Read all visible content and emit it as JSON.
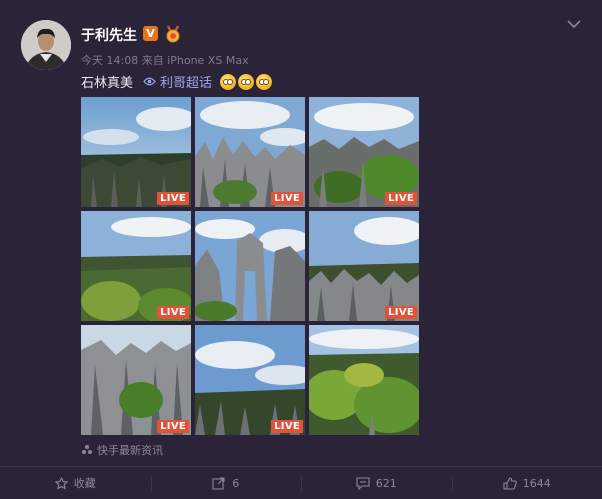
{
  "post": {
    "author": "于利先生",
    "verified_badge": "V",
    "time": "今天 14:08 来自 iPhone XS Max",
    "text": "石林真美",
    "topic": "利哥超话",
    "source_label": "快手最新资讯",
    "photo_badge": "LIVE",
    "photos": [
      {
        "live": true
      },
      {
        "live": true
      },
      {
        "live": true
      },
      {
        "live": true
      },
      {
        "live": false
      },
      {
        "live": true
      },
      {
        "live": true
      },
      {
        "live": true
      },
      {
        "live": false
      }
    ]
  },
  "actions": {
    "favorite": "收藏",
    "repost": "6",
    "comment": "621",
    "like": "1644"
  },
  "colors": {
    "background": "#2b2438",
    "topic": "#9da6ee",
    "live_badge": "#e0533a",
    "verified": "#e8731a"
  },
  "icons": [
    "chevron-down-icon",
    "topic-icon",
    "source-icon",
    "favorite-icon",
    "repost-icon",
    "comment-icon",
    "like-icon"
  ]
}
